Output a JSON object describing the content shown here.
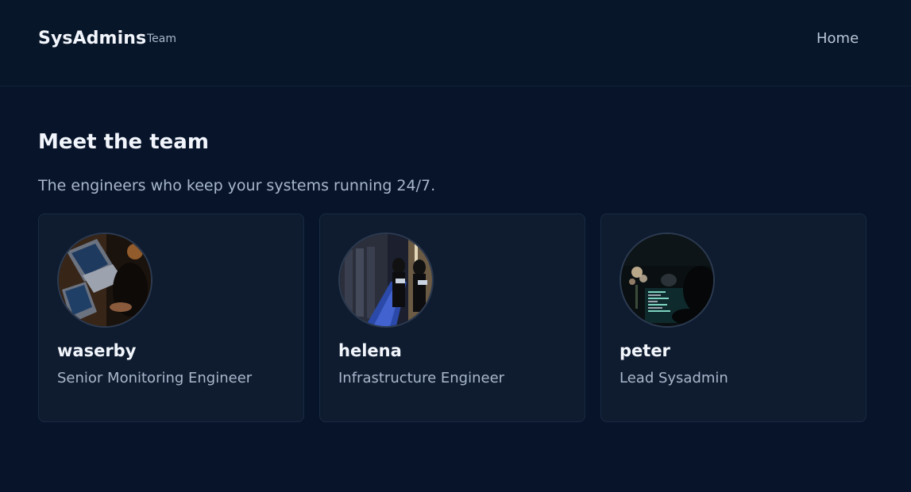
{
  "header": {
    "brand": "SysAdmins",
    "brand_sub": "Team",
    "nav": {
      "home": "Home"
    }
  },
  "main": {
    "title": "Meet the team",
    "subtitle": "The engineers who keep your systems running 24/7.",
    "members": [
      {
        "name": "waserby",
        "role": "Senior Monitoring Engineer"
      },
      {
        "name": "helena",
        "role": "Infrastructure Engineer"
      },
      {
        "name": "peter",
        "role": "Lead Sysadmin"
      }
    ]
  },
  "colors": {
    "background": "#07142a",
    "card": "#0f1c30",
    "text_primary": "#f2f6fc",
    "text_secondary": "#a9b7cc"
  }
}
